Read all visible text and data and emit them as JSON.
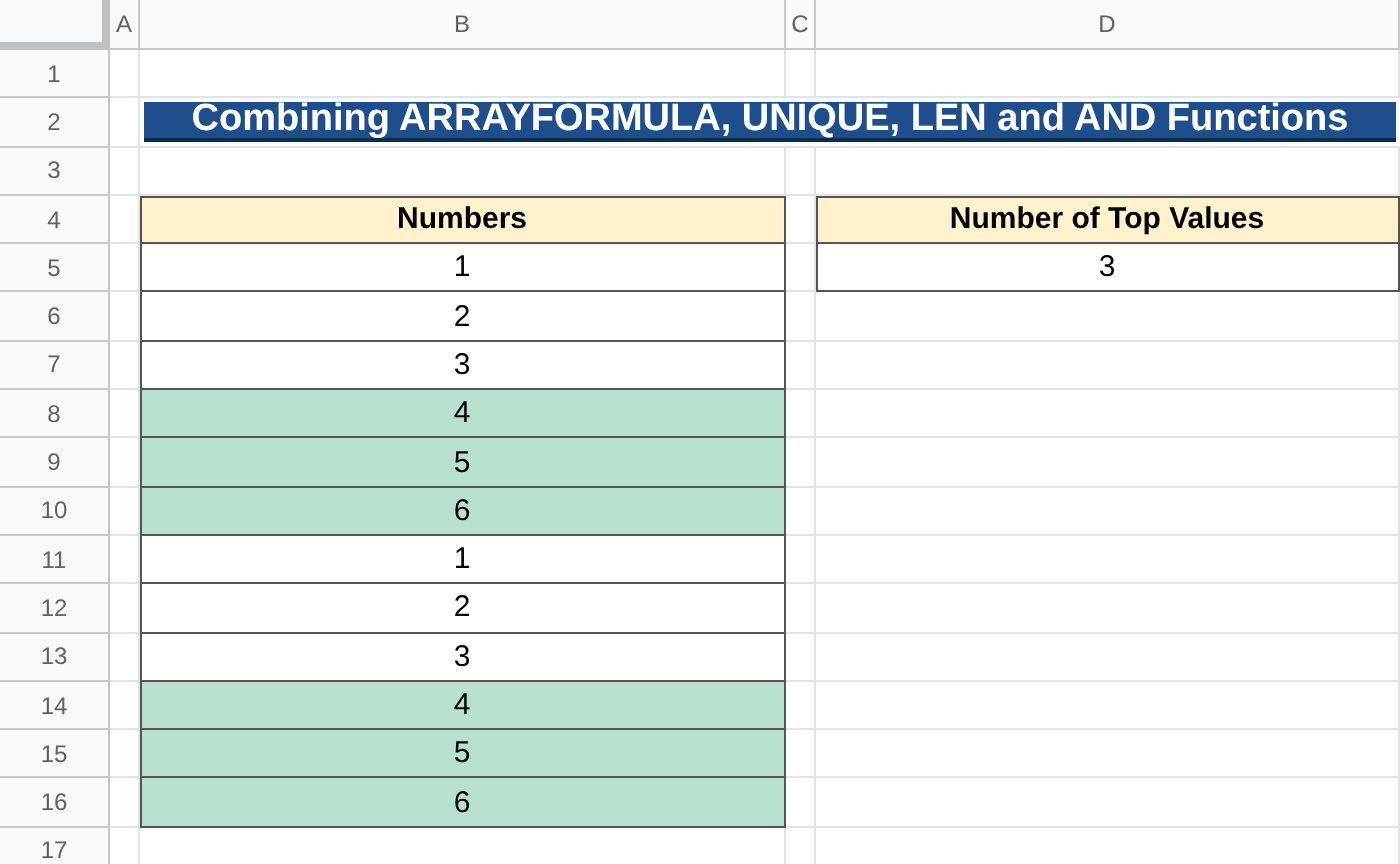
{
  "column_headers": [
    "A",
    "B",
    "C",
    "D"
  ],
  "row_headers": [
    "1",
    "2",
    "3",
    "4",
    "5",
    "6",
    "7",
    "8",
    "9",
    "10",
    "11",
    "12",
    "13",
    "14",
    "15",
    "16",
    "17"
  ],
  "title": "Combining ARRAYFORMULA, UNIQUE, LEN and AND Functions",
  "numbers_table": {
    "header": "Numbers",
    "rows": [
      {
        "value": "1",
        "highlighted": false
      },
      {
        "value": "2",
        "highlighted": false
      },
      {
        "value": "3",
        "highlighted": false
      },
      {
        "value": "4",
        "highlighted": true
      },
      {
        "value": "5",
        "highlighted": true
      },
      {
        "value": "6",
        "highlighted": true
      },
      {
        "value": "1",
        "highlighted": false
      },
      {
        "value": "2",
        "highlighted": false
      },
      {
        "value": "3",
        "highlighted": false
      },
      {
        "value": "4",
        "highlighted": true
      },
      {
        "value": "5",
        "highlighted": true
      },
      {
        "value": "6",
        "highlighted": true
      }
    ]
  },
  "top_values_table": {
    "header": "Number of Top Values",
    "value": "3"
  }
}
